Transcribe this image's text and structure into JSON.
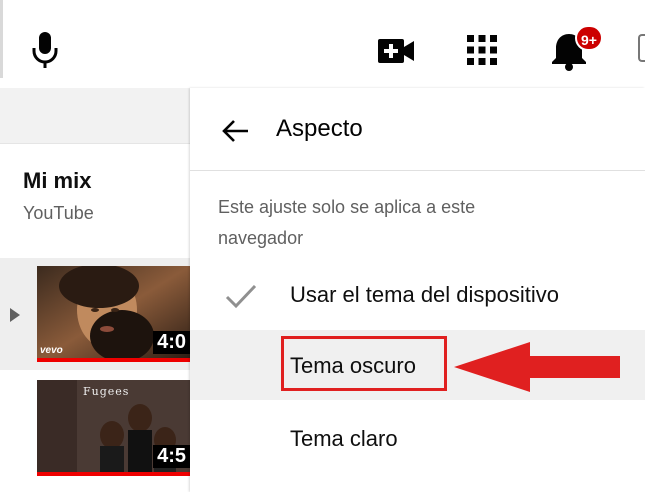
{
  "topbar": {
    "icons": [
      "mic-icon",
      "create-video-icon",
      "apps-grid-icon",
      "notifications-bell-icon"
    ],
    "notification_badge": "9+"
  },
  "playlist": {
    "title": "Mi mix",
    "channel": "YouTube",
    "items": [
      {
        "duration": "4:0",
        "watermark": "vevo",
        "active": true
      },
      {
        "duration": "4:5",
        "album_text": "Fugees",
        "active": false
      }
    ]
  },
  "appearance_menu": {
    "title": "Aspecto",
    "note": "Este ajuste solo se aplica a este navegador",
    "options": [
      {
        "label": "Usar el tema del dispositivo",
        "checked": true
      },
      {
        "label": "Tema oscuro",
        "checked": false,
        "hovered": true
      },
      {
        "label": "Tema claro",
        "checked": false
      }
    ]
  },
  "annotation": {
    "highlight_color": "#e02020",
    "arrow_color": "#e02020"
  }
}
